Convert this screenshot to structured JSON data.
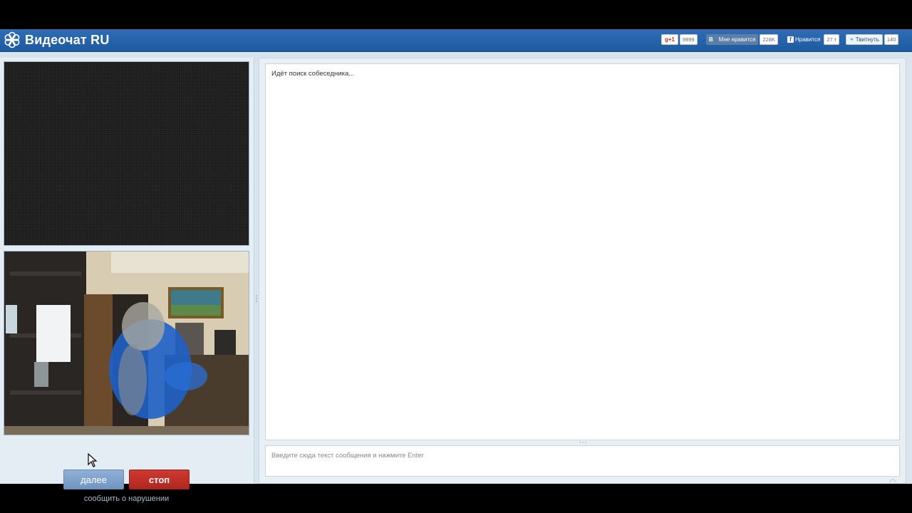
{
  "app": {
    "title": "Видеочат RU"
  },
  "social": {
    "google": {
      "label": "g+1",
      "count": "9999"
    },
    "vk": {
      "label": "Мне нравится",
      "count": "228K"
    },
    "facebook": {
      "label": "Нравится",
      "count": "27 т"
    },
    "twitter": {
      "label": "Твитнуть",
      "count": "140"
    }
  },
  "controls": {
    "next_label": "далее",
    "stop_label": "стоп",
    "report_label": "сообщить о нарушении"
  },
  "chat": {
    "status_message": "Идёт поиск собеседника...",
    "input_placeholder": "Введите сюда текст сообщения и нажмите Enter"
  },
  "colors": {
    "header_blue": "#1e5aa0",
    "next_button": "#7b9fca",
    "stop_button": "#c0302a"
  },
  "icons": {
    "logo": "flower-logo-icon",
    "cursor": "mouse-pointer-icon"
  }
}
